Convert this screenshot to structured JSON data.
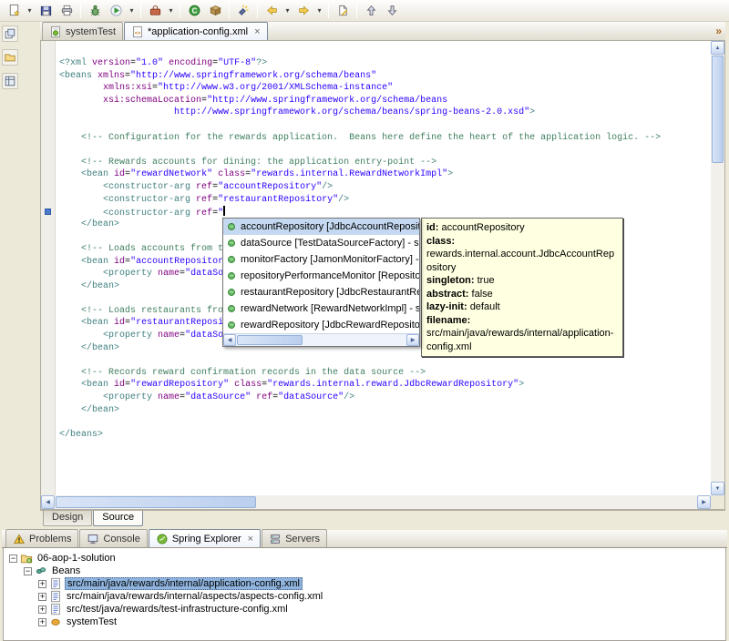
{
  "colors": {
    "frame_bg": "#ECE9D8",
    "tag": "#3F7F7F",
    "attribute": "#7F007F",
    "value": "#2A00FF",
    "comment": "#3F7F5F",
    "tooltip_bg": "#FFFFE1",
    "selection_blue": "#8FB4DE"
  },
  "toolbar": {
    "items": [
      "new-wizard",
      "dropdown",
      "save",
      "print",
      "sep",
      "debug",
      "run",
      "dropdown",
      "sep",
      "external-tools",
      "dropdown",
      "sep",
      "new-class",
      "new-package",
      "sep",
      "search",
      "sep",
      "back",
      "dropdown",
      "forward",
      "dropdown",
      "sep",
      "last-edit",
      "sep",
      "prev-annotation",
      "next-annotation"
    ]
  },
  "left_strip": {
    "icons": [
      "minimized-view-1",
      "minimized-view-2",
      "minimized-view-3"
    ]
  },
  "tab_overflow": "»",
  "editor_tabs": [
    {
      "label": "systemTest",
      "icon": "spring-config",
      "active": false,
      "closable": false
    },
    {
      "label": "*application-config.xml",
      "icon": "xml-file",
      "active": true,
      "closable": true
    }
  ],
  "editor": {
    "cursor_line": 13,
    "lines": [
      [
        [
          "g",
          "<?xml "
        ],
        [
          "a",
          "version"
        ],
        [
          "t",
          "="
        ],
        [
          "v",
          "\"1.0\""
        ],
        [
          "t",
          " "
        ],
        [
          "a",
          "encoding"
        ],
        [
          "t",
          "="
        ],
        [
          "v",
          "\"UTF-8\""
        ],
        [
          "g",
          "?>"
        ]
      ],
      [
        [
          "g",
          "<beans "
        ],
        [
          "a",
          "xmlns"
        ],
        [
          "t",
          "="
        ],
        [
          "v",
          "\"http://www.springframework.org/schema/beans\""
        ]
      ],
      [
        [
          "t",
          "        "
        ],
        [
          "a",
          "xmlns:xsi"
        ],
        [
          "t",
          "="
        ],
        [
          "v",
          "\"http://www.w3.org/2001/XMLSchema-instance\""
        ]
      ],
      [
        [
          "t",
          "        "
        ],
        [
          "a",
          "xsi:schemaLocation"
        ],
        [
          "t",
          "="
        ],
        [
          "v",
          "\"http://www.springframework.org/schema/beans"
        ]
      ],
      [
        [
          "t",
          "                     "
        ],
        [
          "v",
          "http://www.springframework.org/schema/beans/spring-beans-2.0.xsd\""
        ],
        [
          "g",
          ">"
        ]
      ],
      [],
      [
        [
          "t",
          "    "
        ],
        [
          "c",
          "<!-- Configuration for the rewards application.  Beans here define the heart of the application logic. -->"
        ]
      ],
      [],
      [
        [
          "t",
          "    "
        ],
        [
          "c",
          "<!-- Rewards accounts for dining: the application entry-point -->"
        ]
      ],
      [
        [
          "t",
          "    "
        ],
        [
          "g",
          "<bean "
        ],
        [
          "a",
          "id"
        ],
        [
          "t",
          "="
        ],
        [
          "v",
          "\"rewardNetwork\""
        ],
        [
          "t",
          " "
        ],
        [
          "a",
          "class"
        ],
        [
          "t",
          "="
        ],
        [
          "v",
          "\"rewards.internal.RewardNetworkImpl\""
        ],
        [
          "g",
          ">"
        ]
      ],
      [
        [
          "t",
          "        "
        ],
        [
          "g",
          "<constructor-arg "
        ],
        [
          "a",
          "ref"
        ],
        [
          "t",
          "="
        ],
        [
          "v",
          "\"accountRepository\""
        ],
        [
          "g",
          "/>"
        ]
      ],
      [
        [
          "t",
          "        "
        ],
        [
          "g",
          "<constructor-arg "
        ],
        [
          "a",
          "ref"
        ],
        [
          "t",
          "="
        ],
        [
          "v",
          "\"restaurantRepository\""
        ],
        [
          "g",
          "/>"
        ]
      ],
      [
        [
          "t",
          "        "
        ],
        [
          "g",
          "<constructor-arg "
        ],
        [
          "a",
          "ref"
        ],
        [
          "t",
          "="
        ],
        [
          "v",
          "\""
        ],
        [
          "k",
          ""
        ]
      ],
      [
        [
          "t",
          "    "
        ],
        [
          "g",
          "</bean>"
        ]
      ],
      [],
      [
        [
          "t",
          "    "
        ],
        [
          "c",
          "<!-- Loads accounts from t"
        ]
      ],
      [
        [
          "t",
          "    "
        ],
        [
          "g",
          "<bean "
        ],
        [
          "a",
          "id"
        ],
        [
          "t",
          "="
        ],
        [
          "v",
          "\"accountRepositor"
        ]
      ],
      [
        [
          "t",
          "        "
        ],
        [
          "g",
          "<property "
        ],
        [
          "a",
          "name"
        ],
        [
          "t",
          "="
        ],
        [
          "v",
          "\"dataSo"
        ]
      ],
      [
        [
          "t",
          "    "
        ],
        [
          "g",
          "</bean>"
        ]
      ],
      [],
      [
        [
          "t",
          "    "
        ],
        [
          "c",
          "<!-- Loads restaurants fro"
        ]
      ],
      [
        [
          "t",
          "    "
        ],
        [
          "g",
          "<bean "
        ],
        [
          "a",
          "id"
        ],
        [
          "t",
          "="
        ],
        [
          "v",
          "\"restaurantReposi"
        ]
      ],
      [
        [
          "t",
          "        "
        ],
        [
          "g",
          "<property "
        ],
        [
          "a",
          "name"
        ],
        [
          "t",
          "="
        ],
        [
          "v",
          "\"dataSo"
        ]
      ],
      [
        [
          "t",
          "    "
        ],
        [
          "g",
          "</bean>"
        ]
      ],
      [],
      [
        [
          "t",
          "    "
        ],
        [
          "c",
          "<!-- Records reward confirmation records in the data source -->"
        ]
      ],
      [
        [
          "t",
          "    "
        ],
        [
          "g",
          "<bean "
        ],
        [
          "a",
          "id"
        ],
        [
          "t",
          "="
        ],
        [
          "v",
          "\"rewardRepository\""
        ],
        [
          "t",
          " "
        ],
        [
          "a",
          "class"
        ],
        [
          "t",
          "="
        ],
        [
          "v",
          "\"rewards.internal.reward.JdbcRewardRepository\""
        ],
        [
          "g",
          ">"
        ]
      ],
      [
        [
          "t",
          "        "
        ],
        [
          "g",
          "<property "
        ],
        [
          "a",
          "name"
        ],
        [
          "t",
          "="
        ],
        [
          "v",
          "\"dataSource\""
        ],
        [
          "t",
          " "
        ],
        [
          "a",
          "ref"
        ],
        [
          "t",
          "="
        ],
        [
          "v",
          "\"dataSource\""
        ],
        [
          "g",
          "/>"
        ]
      ],
      [
        [
          "t",
          "    "
        ],
        [
          "g",
          "</bean>"
        ]
      ],
      [],
      [
        [
          "g",
          "</beans>"
        ]
      ]
    ]
  },
  "content_assist": {
    "items": [
      {
        "text": "accountRepository [JdbcAccountRepository] - src/",
        "selected": true
      },
      {
        "text": "dataSource [TestDataSourceFactory] - src/test/ja",
        "selected": false
      },
      {
        "text": "monitorFactory [JamonMonitorFactory] - src/main",
        "selected": false
      },
      {
        "text": "repositoryPerformanceMonitor [RepositoryPerfor",
        "selected": false
      },
      {
        "text": "restaurantRepository [JdbcRestaurantRepository",
        "selected": false
      },
      {
        "text": "rewardNetwork [RewardNetworkImpl] - src/main/j",
        "selected": false
      },
      {
        "text": "rewardRepository [JdbcRewardRepository] - src/r",
        "selected": false
      }
    ]
  },
  "tooltip": {
    "rows": [
      {
        "label": "id:",
        "value": "accountRepository",
        "break": false
      },
      {
        "label": "class:",
        "value": "rewards.internal.account.JdbcAccountRepository",
        "break": true
      },
      {
        "label": "singleton:",
        "value": "true",
        "break": false
      },
      {
        "label": "abstract:",
        "value": "false",
        "break": false
      },
      {
        "label": "lazy-init:",
        "value": "default",
        "break": false
      },
      {
        "label": "filename:",
        "value": "src/main/java/rewards/internal/application-config.xml",
        "break": false
      }
    ]
  },
  "mode_tabs": [
    {
      "label": "Design",
      "active": false
    },
    {
      "label": "Source",
      "active": true
    }
  ],
  "bottom_tabs": [
    {
      "label": "Problems",
      "icon": "problems",
      "active": false,
      "closable": false
    },
    {
      "label": "Console",
      "icon": "console",
      "active": false,
      "closable": false
    },
    {
      "label": "Spring Explorer",
      "icon": "spring",
      "active": true,
      "closable": true
    },
    {
      "label": "Servers",
      "icon": "servers",
      "active": false,
      "closable": false
    }
  ],
  "tree": {
    "items": [
      {
        "label": "06-aop-1-solution",
        "level": 0,
        "expander": "minus",
        "icon": "project",
        "selected": false
      },
      {
        "label": "Beans",
        "level": 1,
        "expander": "minus",
        "icon": "beans",
        "selected": false
      },
      {
        "label": "src/main/java/rewards/internal/application-config.xml",
        "level": 2,
        "expander": "plus",
        "icon": "config",
        "selected": true
      },
      {
        "label": "src/main/java/rewards/internal/aspects/aspects-config.xml",
        "level": 2,
        "expander": "plus",
        "icon": "config",
        "selected": false
      },
      {
        "label": "src/test/java/rewards/test-infrastructure-config.xml",
        "level": 2,
        "expander": "plus",
        "icon": "config",
        "selected": false
      },
      {
        "label": "systemTest",
        "level": 2,
        "expander": "plus",
        "icon": "bean",
        "selected": false
      }
    ]
  }
}
